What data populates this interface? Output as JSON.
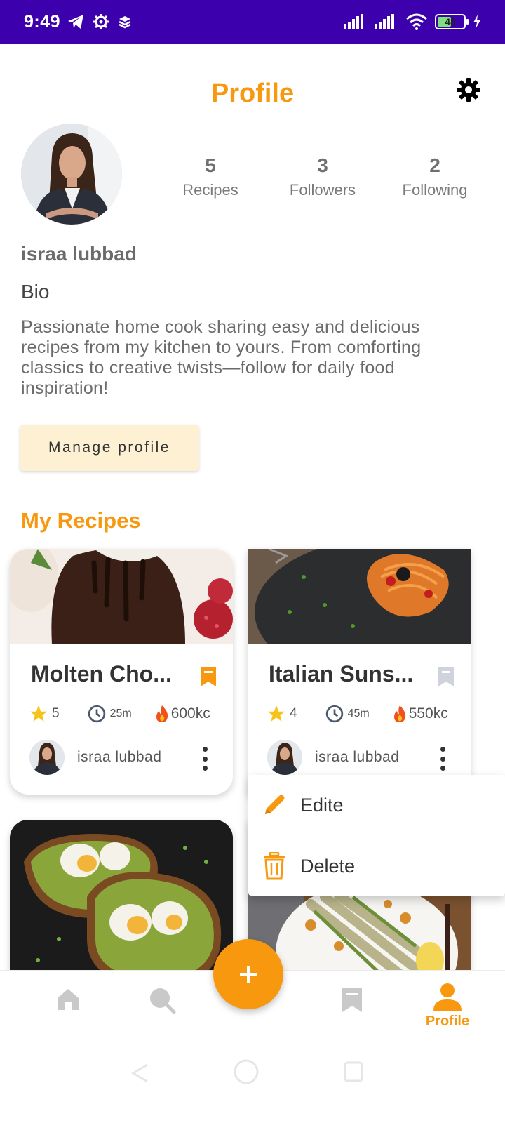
{
  "status_bar": {
    "time": "9:49",
    "battery": "48",
    "battery_level": 0.48
  },
  "header": {
    "title": "Profile",
    "settings_icon": "gear-icon"
  },
  "profile": {
    "stats": [
      {
        "value": "5",
        "label": "Recipes"
      },
      {
        "value": "3",
        "label": "Followers"
      },
      {
        "value": "2",
        "label": "Following"
      }
    ],
    "name": "israa lubbad",
    "bio_label": "Bio",
    "bio": "Passionate home cook sharing easy and delicious recipes from my kitchen to yours. From comforting classics to creative twists—follow for daily food inspiration!",
    "manage_button": "Manage profile"
  },
  "recipes_section": {
    "title": "My Recipes",
    "cards": [
      {
        "title": "Molten Cho...",
        "rating": "5",
        "time": "25m",
        "calories": "600kc",
        "author": "israa lubbad",
        "bookmarked": true
      },
      {
        "title": "Italian Suns...",
        "rating": "4",
        "time": "45m",
        "calories": "550kc",
        "author": "israa lubbad",
        "bookmarked": false
      }
    ]
  },
  "context_menu": {
    "items": [
      {
        "label": "Edite",
        "icon": "pencil-icon"
      },
      {
        "label": "Delete",
        "icon": "trash-icon"
      }
    ]
  },
  "bottom_nav": {
    "active_label": "Profile",
    "items": [
      "home-icon",
      "search-icon",
      "add-icon",
      "bookmark-icon",
      "profile-icon"
    ]
  },
  "colors": {
    "accent": "#f7980f",
    "status_bar": "#3c00ac",
    "button_bg": "#fdf0d3",
    "inactive_icon": "#c9c9c9"
  }
}
